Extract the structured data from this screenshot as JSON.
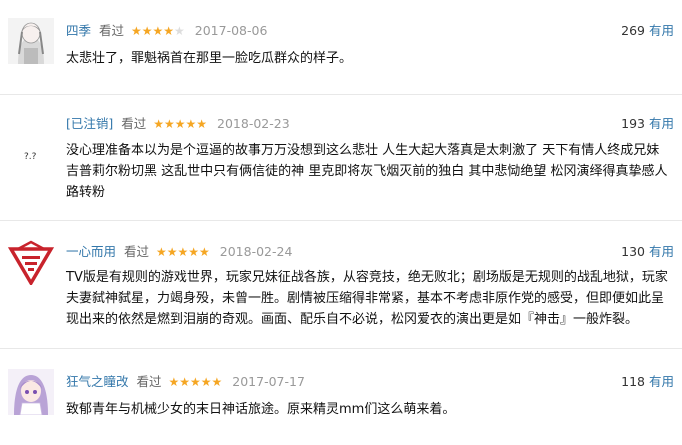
{
  "reviews": [
    {
      "author": "四季",
      "watched": "看过",
      "rating_stars": 4,
      "stars_full": "★★★★",
      "stars_empty": "★",
      "date": "2017-08-06",
      "votes": "269",
      "useful_label": "有用",
      "avatar": "anime-girl-sketch-avatar",
      "text": "太悲壮了，罪魁祸首在那里一脸吃瓜群众的样子。"
    },
    {
      "author": "[已注销]",
      "watched": "看过",
      "rating_stars": 5,
      "stars_full": "★★★★★",
      "stars_empty": "",
      "date": "2018-02-23",
      "votes": "193",
      "useful_label": "有用",
      "avatar": "deleted-user-avatar",
      "avatar_text": "?.?",
      "text": "没心理准备本以为是个逗逼的故事万万没想到这么悲壮 人生大起大落真是太刺激了 天下有情人终成兄妹 吉普莉尔粉切黑 这乱世中只有俩信徒的神 里克即将灰飞烟灭前的独白 其中悲恸绝望 松冈演绎得真挚感人 路转粉"
    },
    {
      "author": "一心而用",
      "watched": "看过",
      "rating_stars": 5,
      "stars_full": "★★★★★",
      "stars_empty": "",
      "date": "2018-02-24",
      "votes": "130",
      "useful_label": "有用",
      "avatar": "red-emblem-avatar",
      "text": "TV版是有规则的游戏世界，玩家兄妹征战各族，从容竞技，绝无败北；剧场版是无规则的战乱地狱，玩家夫妻弑神弑星，力竭身殁，未曾一胜。剧情被压缩得非常紧，基本不考虑非原作党的感受，但即便如此呈现出来的依然是燃到泪崩的奇观。画面、配乐自不必说，松冈爱衣的演出更是如『神击』一般炸裂。"
    },
    {
      "author": "狂气之瞳改",
      "watched": "看过",
      "rating_stars": 5,
      "stars_full": "★★★★★",
      "stars_empty": "",
      "date": "2017-07-17",
      "votes": "118",
      "useful_label": "有用",
      "avatar": "purple-hair-anime-girl-avatar",
      "text": "致郁青年与机械少女的末日神话旅途。原来精灵mm们这么萌来着。"
    }
  ],
  "colors": {
    "link": "#3377aa",
    "star": "#f5a623",
    "muted": "#999999",
    "divider": "#e8e8e8",
    "emblem_red": "#c8232c"
  }
}
